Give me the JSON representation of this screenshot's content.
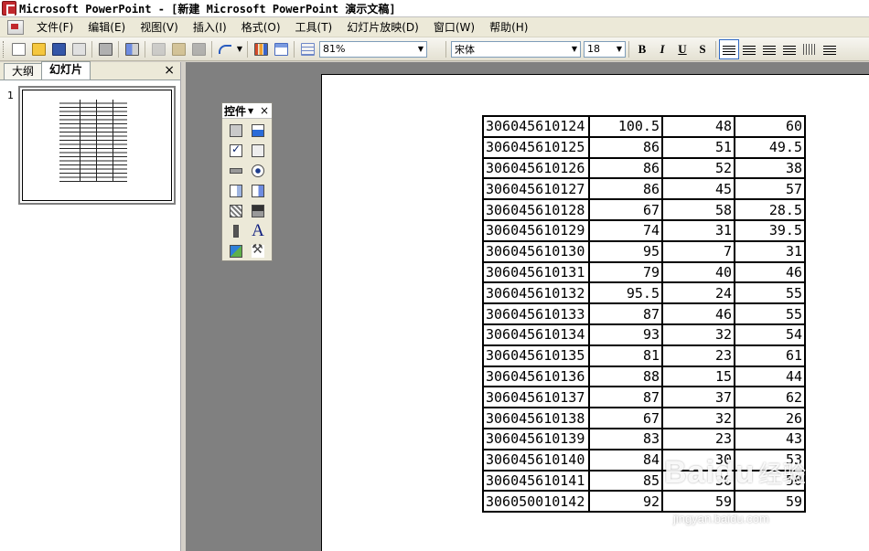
{
  "window": {
    "title": "Microsoft PowerPoint - [新建 Microsoft PowerPoint 演示文稿]"
  },
  "menubar": {
    "items": [
      "文件(F)",
      "编辑(E)",
      "视图(V)",
      "插入(I)",
      "格式(O)",
      "工具(T)",
      "幻灯片放映(D)",
      "窗口(W)",
      "帮助(H)"
    ]
  },
  "toolbar": {
    "zoom": "81%",
    "font_name": "宋体",
    "font_size": "18",
    "bold": "B",
    "italic": "I",
    "underline": "U",
    "shadow": "S"
  },
  "left_pane": {
    "tabs": [
      "大纲",
      "幻灯片"
    ],
    "active_tab": "幻灯片",
    "close": "×",
    "slide_number": "1"
  },
  "control_toolbox": {
    "title": "控件",
    "close": "×",
    "label_a": "A"
  },
  "slide_table": {
    "rows": [
      [
        "306045610124",
        "100.5",
        "48",
        "60"
      ],
      [
        "306045610125",
        "86",
        "51",
        "49.5"
      ],
      [
        "306045610126",
        "86",
        "52",
        "38"
      ],
      [
        "306045610127",
        "86",
        "45",
        "57"
      ],
      [
        "306045610128",
        "67",
        "58",
        "28.5"
      ],
      [
        "306045610129",
        "74",
        "31",
        "39.5"
      ],
      [
        "306045610130",
        "95",
        "7",
        "31"
      ],
      [
        "306045610131",
        "79",
        "40",
        "46"
      ],
      [
        "306045610132",
        "95.5",
        "24",
        "55"
      ],
      [
        "306045610133",
        "87",
        "46",
        "55"
      ],
      [
        "306045610134",
        "93",
        "32",
        "54"
      ],
      [
        "306045610135",
        "81",
        "23",
        "61"
      ],
      [
        "306045610136",
        "88",
        "15",
        "44"
      ],
      [
        "306045610137",
        "87",
        "37",
        "62"
      ],
      [
        "306045610138",
        "67",
        "32",
        "26"
      ],
      [
        "306045610139",
        "83",
        "23",
        "43"
      ],
      [
        "306045610140",
        "84",
        "30",
        "53"
      ],
      [
        "306045610141",
        "85",
        "36",
        "50"
      ],
      [
        "306050010142",
        "92",
        "59",
        "59"
      ]
    ]
  },
  "watermark": {
    "logo": "Baidu",
    "logo_cn": "经验",
    "url": "jingyan.baidu.com"
  }
}
